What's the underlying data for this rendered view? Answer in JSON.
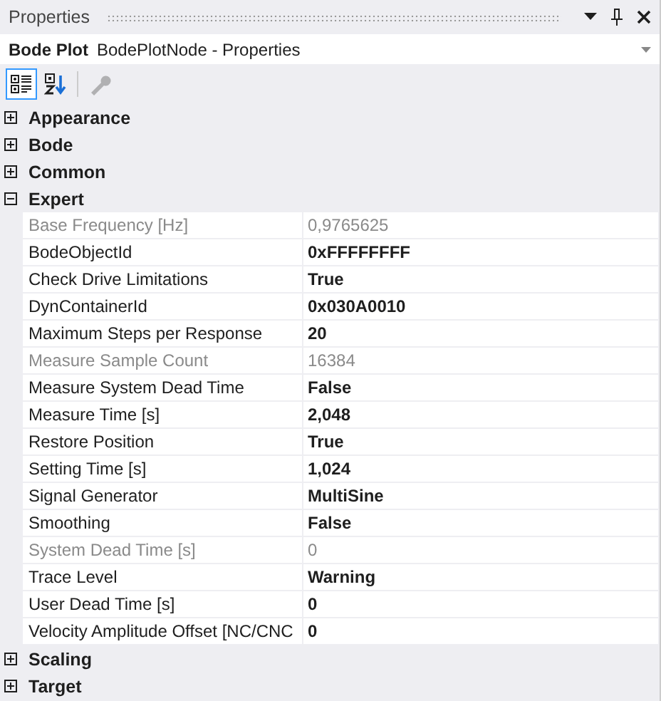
{
  "panel": {
    "title": "Properties"
  },
  "object_selector": {
    "name": "Bode Plot",
    "type": "BodePlotNode - Properties"
  },
  "toolbar": [
    {
      "kind": "categorized",
      "selected": true,
      "disabled": false
    },
    {
      "kind": "alphabetical",
      "selected": false,
      "disabled": false
    },
    {
      "kind": "property-pages",
      "selected": false,
      "disabled": true
    }
  ],
  "categories": [
    {
      "name": "Appearance",
      "expanded": false
    },
    {
      "name": "Bode",
      "expanded": false
    },
    {
      "name": "Common",
      "expanded": false
    },
    {
      "name": "Expert",
      "expanded": true,
      "children": [
        {
          "name": "Base Frequency [Hz]",
          "value": "0,9765625",
          "disabled": true
        },
        {
          "name": "BodeObjectId",
          "value": "0xFFFFFFFF",
          "disabled": false
        },
        {
          "name": "Check Drive Limitations",
          "value": "True",
          "disabled": false
        },
        {
          "name": "DynContainerId",
          "value": "0x030A0010",
          "disabled": false
        },
        {
          "name": "Maximum Steps per Response",
          "value": "20",
          "disabled": false
        },
        {
          "name": "Measure Sample Count",
          "value": "16384",
          "disabled": true
        },
        {
          "name": "Measure System Dead Time",
          "value": "False",
          "disabled": false
        },
        {
          "name": "Measure Time [s]",
          "value": "2,048",
          "disabled": false
        },
        {
          "name": "Restore Position",
          "value": "True",
          "disabled": false
        },
        {
          "name": "Setting Time [s]",
          "value": "1,024",
          "disabled": false
        },
        {
          "name": "Signal Generator",
          "value": "MultiSine",
          "disabled": false
        },
        {
          "name": "Smoothing",
          "value": "False",
          "disabled": false
        },
        {
          "name": "System Dead Time [s]",
          "value": "0",
          "disabled": true
        },
        {
          "name": "Trace Level",
          "value": "Warning",
          "disabled": false
        },
        {
          "name": "User Dead Time [s]",
          "value": "0",
          "disabled": false
        },
        {
          "name": "Velocity Amplitude Offset [NC/CNC",
          "value": "0",
          "disabled": false
        }
      ]
    },
    {
      "name": "Scaling",
      "expanded": false
    },
    {
      "name": "Target",
      "expanded": false
    }
  ]
}
